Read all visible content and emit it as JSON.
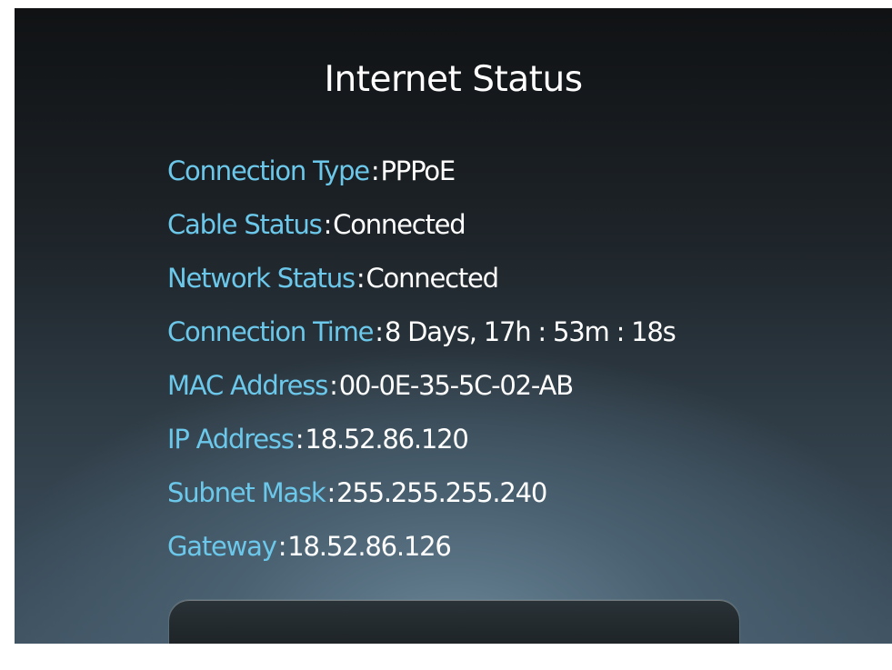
{
  "title": "Internet Status",
  "separator": ":",
  "rows": [
    {
      "label": "Connection Type",
      "value": "PPPoE"
    },
    {
      "label": "Cable Status",
      "value": "Connected"
    },
    {
      "label": "Network Status",
      "value": "Connected"
    },
    {
      "label": "Connection Time",
      "value": "8 Days, 17h : 53m : 18s"
    },
    {
      "label": "MAC Address",
      "value": "00-0E-35-5C-02-AB"
    },
    {
      "label": "IP Address",
      "value": "18.52.86.120"
    },
    {
      "label": "Subnet Mask",
      "value": "255.255.255.240"
    },
    {
      "label": "Gateway",
      "value": "18.52.86.126"
    }
  ],
  "colors": {
    "label": "#6cc8ea",
    "value": "#ffffff",
    "title": "#ffffff"
  }
}
